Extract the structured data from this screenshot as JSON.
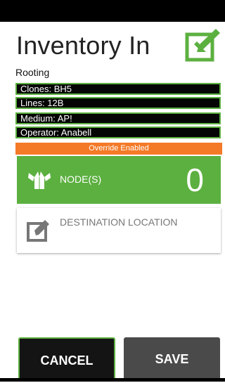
{
  "header": {
    "title": "Inventory In",
    "subtitle": "Rooting",
    "icon": "edit-check-icon"
  },
  "info": [
    "Clones: BH5",
    "Lines: 12B",
    "Medium: AP!",
    "Operator: Anabell"
  ],
  "banner": {
    "text": "Override Enabled",
    "color": "#f47a27"
  },
  "nodes": {
    "label": "NODE(S)",
    "count": "0",
    "icon": "open-box-icon",
    "color": "#5cb040"
  },
  "destination": {
    "label": "DESTINATION LOCATION",
    "icon": "edit-icon"
  },
  "footer": {
    "cancel_label": "CANCEL",
    "save_label": "SAVE"
  }
}
